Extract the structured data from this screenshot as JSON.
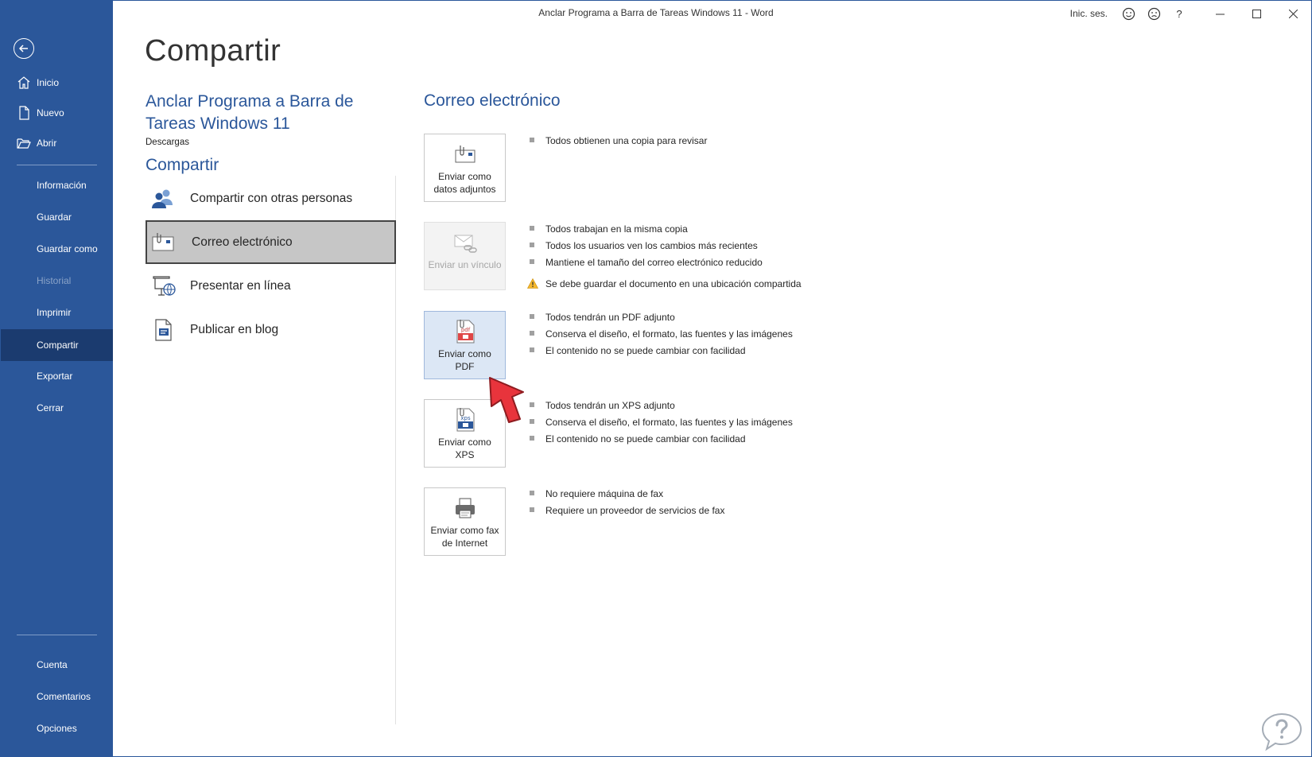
{
  "window": {
    "title": "Anclar Programa a Barra de Tareas Windows 11  -  Word"
  },
  "titlebar": {
    "signin": "Inic. ses.",
    "help": "?"
  },
  "sidebar": {
    "top_items": [
      {
        "label": "Inicio",
        "icon": "home-icon"
      },
      {
        "label": "Nuevo",
        "icon": "new-document-icon"
      },
      {
        "label": "Abrir",
        "icon": "open-folder-icon"
      }
    ],
    "mid_items": [
      {
        "label": "Información"
      },
      {
        "label": "Guardar"
      },
      {
        "label": "Guardar como"
      },
      {
        "label": "Historial",
        "state": "disabled"
      },
      {
        "label": "Imprimir"
      },
      {
        "label": "Compartir",
        "state": "active"
      },
      {
        "label": "Exportar"
      },
      {
        "label": "Cerrar"
      }
    ],
    "bottom_items": [
      {
        "label": "Cuenta"
      },
      {
        "label": "Comentarios"
      },
      {
        "label": "Opciones"
      }
    ]
  },
  "main": {
    "page_title": "Compartir",
    "document_name": "Anclar Programa a Barra de Tareas Windows 11",
    "document_location": "Descargas",
    "section_title": "Compartir",
    "share_options": [
      {
        "label": "Compartir con otras personas",
        "icon": "people-icon"
      },
      {
        "label": "Correo electrónico",
        "icon": "email-icon",
        "selected": true
      },
      {
        "label": "Presentar en línea",
        "icon": "present-online-icon"
      },
      {
        "label": "Publicar en blog",
        "icon": "blog-icon"
      }
    ]
  },
  "email_panel": {
    "title": "Correo electrónico",
    "options": [
      {
        "label": "Enviar como datos adjuntos",
        "icon": "email-attachment-icon",
        "state": "normal",
        "bullets": [
          "Todos obtienen una copia para revisar"
        ],
        "warning": ""
      },
      {
        "label": "Enviar un vínculo",
        "icon": "email-link-icon",
        "state": "disabled",
        "bullets": [
          "Todos trabajan en la misma copia",
          "Todos los usuarios ven los cambios más recientes",
          "Mantiene el tamaño del correo electrónico reducido"
        ],
        "warning": "Se debe guardar el documento en una ubicación compartida"
      },
      {
        "label": "Enviar como PDF",
        "icon": "pdf-icon",
        "state": "hover",
        "bullets": [
          "Todos tendrán un PDF adjunto",
          "Conserva el diseño, el formato, las fuentes y las imágenes",
          "El contenido no se puede cambiar con facilidad"
        ],
        "warning": ""
      },
      {
        "label": "Enviar como XPS",
        "icon": "xps-icon",
        "state": "normal",
        "bullets": [
          "Todos tendrán un XPS adjunto",
          "Conserva el diseño, el formato, las fuentes y las imágenes",
          "El contenido no se puede cambiar con facilidad"
        ],
        "warning": ""
      },
      {
        "label": "Enviar como fax de Internet",
        "icon": "fax-icon",
        "state": "normal",
        "bullets": [
          "No requiere máquina de fax",
          "Requiere un proveedor de servicios de fax"
        ],
        "warning": ""
      }
    ]
  },
  "colors": {
    "accent": "#2b579a",
    "sidebar_active": "#1b3b6f",
    "pointer": "#e8343c"
  }
}
